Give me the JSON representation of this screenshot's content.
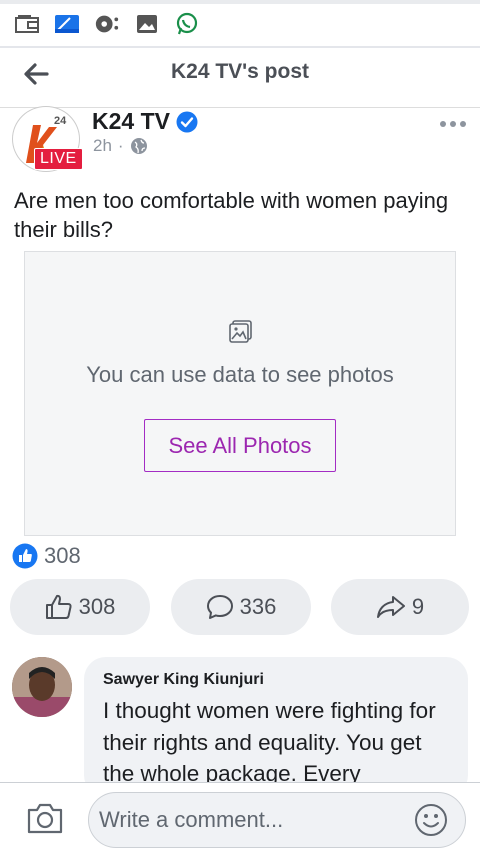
{
  "status_bar": {
    "icons": [
      "wallet-icon",
      "calendar-icon",
      "media-player-icon",
      "gallery-icon",
      "whatsapp-icon"
    ]
  },
  "header": {
    "title": "K24 TV's post",
    "back_icon": "back-arrow-icon"
  },
  "post": {
    "page_name": "K24 TV",
    "verified": true,
    "live_badge": "LIVE",
    "logo_text": "24",
    "time": "2h",
    "separator": "·",
    "privacy_icon": "globe-icon",
    "more_icon": "more-options-icon",
    "text": "Are men too comfortable with women paying their bills?",
    "photo_placeholder": {
      "icon": "image-icon",
      "message": "You can use data to see photos",
      "button_label": "See All Photos"
    }
  },
  "reactions": {
    "icon": "like-reaction-icon",
    "count": "308"
  },
  "actions": {
    "like_count": "308",
    "comment_count": "336",
    "share_count": "9"
  },
  "comments": [
    {
      "author": "Sawyer King Kiunjuri",
      "text": "I thought women were fighting for their rights and equality. You get the whole package. Every"
    }
  ],
  "composer": {
    "placeholder": "Write a comment...",
    "camera_icon": "camera-icon",
    "emoji_icon": "emoji-icon"
  },
  "colors": {
    "accent_blue": "#1877f2",
    "live_red": "#e41e3f",
    "see_all_purple": "#9c27b0"
  }
}
